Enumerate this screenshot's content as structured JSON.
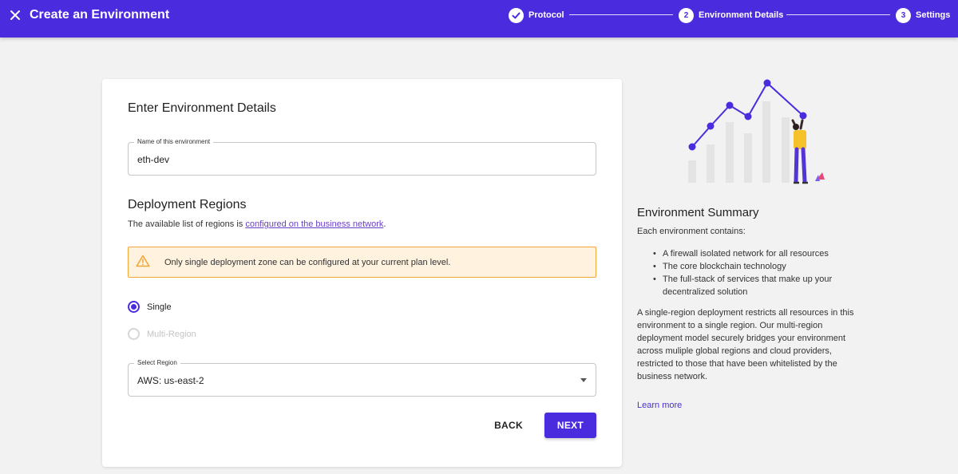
{
  "header": {
    "title": "Create an Environment",
    "close_icon": "close-icon",
    "accent": "#4b2bde"
  },
  "steps": [
    {
      "number": "✓",
      "label": "Protocol",
      "state": "complete"
    },
    {
      "number": "2",
      "label": "Environment Details",
      "state": "active"
    },
    {
      "number": "3",
      "label": "Settings",
      "state": "pending"
    }
  ],
  "form": {
    "title": "Enter Environment Details",
    "name_field": {
      "label": "Name of this environment",
      "value": "eth-dev"
    },
    "regions_title": "Deployment Regions",
    "regions_desc_prefix": "The available list of regions is ",
    "regions_desc_link": "configured on the business network",
    "regions_desc_suffix": ".",
    "warning": {
      "icon": "warning-icon",
      "text": "Only single deployment zone can be configured at your current plan level.",
      "color": "#f3a73b"
    },
    "radio_options": [
      {
        "label": "Single",
        "selected": true,
        "disabled": false
      },
      {
        "label": "Multi-Region",
        "selected": false,
        "disabled": true
      }
    ],
    "region_select": {
      "label": "Select Region",
      "value": "AWS: us-east-2"
    },
    "back_label": "BACK",
    "next_label": "NEXT"
  },
  "summary": {
    "title": "Environment Summary",
    "subtitle": "Each environment contains:",
    "bullets": [
      "A firewall isolated network for all resources",
      "The core blockchain technology",
      "The full-stack of services that make up your decentralized solution"
    ],
    "paragraph": "A single-region deployment restricts all resources in this environment to a single region. Our multi-region deployment model securely bridges your environment across muliple global regions and cloud providers, restricted to those that have been whitelisted by the business network.",
    "learn_more": "Learn more"
  }
}
